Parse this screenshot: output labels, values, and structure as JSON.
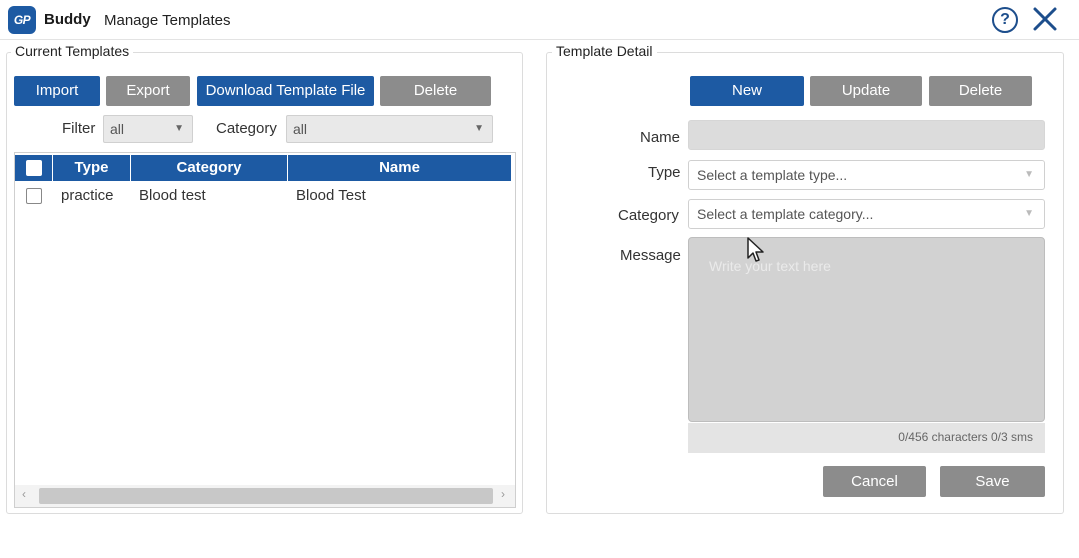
{
  "app": {
    "logo_text": "GP",
    "brand": "Buddy",
    "window_title": "Manage Templates",
    "help_glyph": "?"
  },
  "current_templates": {
    "title": "Current Templates",
    "buttons": {
      "import": "Import",
      "export": "Export",
      "download": "Download Template File",
      "delete": "Delete"
    },
    "filter_label": "Filter",
    "filter_value": "all",
    "category_label": "Category",
    "category_value": "all",
    "table": {
      "columns": [
        "Type",
        "Category",
        "Name"
      ],
      "rows": [
        {
          "type": "practice",
          "category": "Blood test",
          "name": "Blood Test"
        }
      ]
    }
  },
  "template_detail": {
    "title": "Template Detail",
    "buttons": {
      "new": "New",
      "update": "Update",
      "delete": "Delete",
      "cancel": "Cancel",
      "save": "Save"
    },
    "name_label": "Name",
    "type_label": "Type",
    "type_placeholder": "Select a template type...",
    "category_label": "Category",
    "category_placeholder": "Select a template category...",
    "message_label": "Message",
    "message_placeholder": "Write your text here",
    "counter": "0/456 characters 0/3 sms"
  },
  "icons": {
    "help": "help-circle-icon",
    "close": "close-icon",
    "dropdown": "chevron-down-icon",
    "cursor": "mouse-pointer-icon"
  },
  "colors": {
    "primary": "#1d5aa3",
    "disabled_button": "#8c8c8c"
  }
}
